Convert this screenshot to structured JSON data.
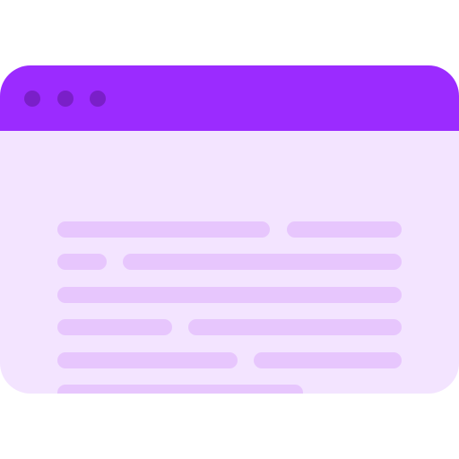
{
  "icon": {
    "name": "browser-window-icon",
    "colors": {
      "titlebar": "#9b2bff",
      "window_dots": "#7a1fc8",
      "content_background": "#f3e4ff",
      "text_lines": "#e7c6fd",
      "page_background": "#ffffff"
    },
    "window_controls": [
      "window-dot",
      "window-dot",
      "window-dot"
    ],
    "content_rows": [
      {
        "segments": [
          "long",
          "medium"
        ]
      },
      {
        "segments": [
          "short",
          "long"
        ]
      },
      {
        "segments": [
          "full"
        ]
      },
      {
        "segments": [
          "medium",
          "long"
        ]
      },
      {
        "segments": [
          "long",
          "medium"
        ]
      },
      {
        "segments": [
          "long"
        ]
      }
    ]
  }
}
